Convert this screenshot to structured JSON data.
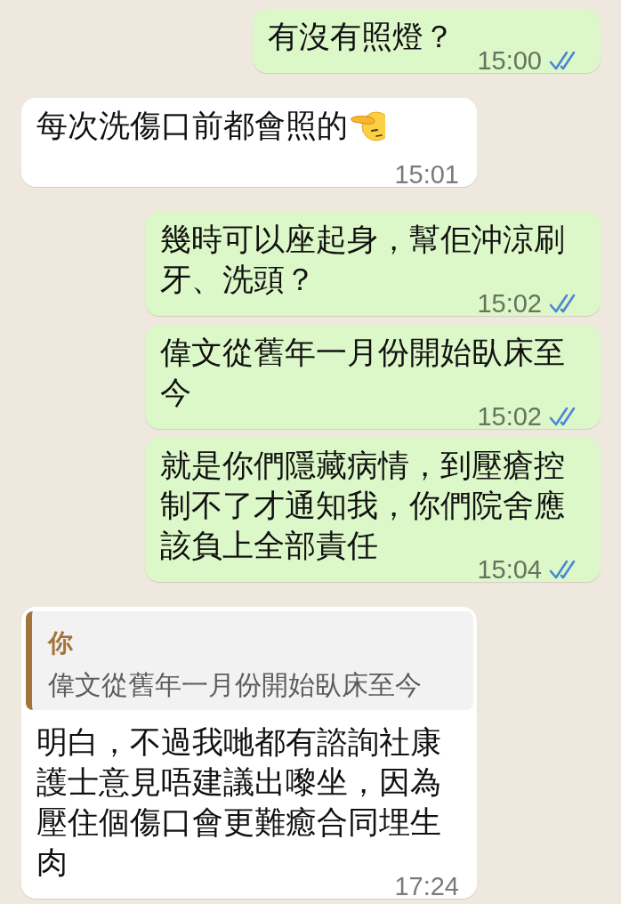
{
  "messages": [
    {
      "kind": "outgoing",
      "text": "有沒有照燈？",
      "time": "15:00",
      "read": true
    },
    {
      "kind": "incoming",
      "text": "每次洗傷口前都會照的",
      "emoji": true,
      "time": "15:01"
    },
    {
      "kind": "outgoing",
      "text": "幾時可以座起身，幫佢沖涼刷牙、洗頭？",
      "time": "15:02",
      "read": true
    },
    {
      "kind": "outgoing",
      "text": "偉文從舊年一月份開始臥床至今",
      "time": "15:02",
      "read": true
    },
    {
      "kind": "outgoing",
      "text": "就是你們隱藏病情，到壓瘡控制不了才通知我，你們院舍應該負上全部責任",
      "time": "15:04",
      "read": true
    },
    {
      "kind": "incoming",
      "quote": {
        "sender": "你",
        "text": "偉文從舊年一月份開始臥床至今"
      },
      "text": "明白，不過我哋都有諮詢社康護士意見唔建議出嚟坐，因為壓住個傷口會更難癒合同埋生肉",
      "time": "17:24"
    }
  ]
}
